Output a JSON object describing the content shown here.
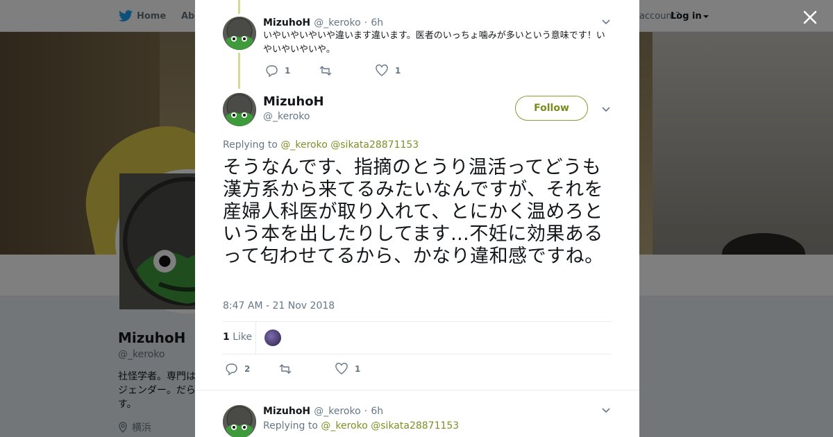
{
  "nav": {
    "home_label": "Home",
    "about_label": "Abo",
    "account_text": "account?",
    "login_label": "Log in"
  },
  "profile": {
    "name": "MizuhoH",
    "handle": "@_keroko",
    "bio": "社怪学者。専門はジェンダー。だらす。",
    "bio_line1": "社怪学者。専門は",
    "bio_line2": "ジェンダー。だら",
    "bio_line3": "す。",
    "location": "横浜"
  },
  "prev_tweet": {
    "name": "MizuhoH",
    "handle": "@_keroko",
    "time": "6h",
    "text": "いやいやいやいや違います違います。医者のいっちょ噛みが多いという意味です！いやいやいやいや。",
    "reply_count": "1",
    "like_count": "1"
  },
  "main_tweet": {
    "name": "MizuhoH",
    "handle": "@_keroko",
    "follow_label": "Follow",
    "replying_prefix": "Replying to",
    "mention1": "@_keroko",
    "mention2": "@sikata28871153",
    "text": "そうなんです、指摘のとうり温活ってどうも漢方系から来てるみたいなんですが、それを産婦人科医が取り入れて、とにかく温めろという本を出したりしてます…不妊に効果あるって匂わせてるから、かなり違和感ですね。",
    "timestamp": "8:47 AM - 21 Nov 2018",
    "likes_count": "1",
    "likes_label": "Like",
    "reply_count": "2",
    "like_count": "1"
  },
  "next_tweet": {
    "name": "MizuhoH",
    "handle": "@_keroko",
    "time": "6h",
    "replying_prefix": "Replying to",
    "mention1": "@_keroko",
    "mention2": "@sikata28871153"
  },
  "colors": {
    "accent": "#7f8f24",
    "thread_line": "#d2db8f",
    "meta_gray": "#657786"
  },
  "icons": [
    "twitter-bird-icon",
    "close-icon",
    "reply-icon",
    "retweet-icon",
    "heart-icon",
    "chevron-down-icon",
    "location-pin-icon"
  ]
}
